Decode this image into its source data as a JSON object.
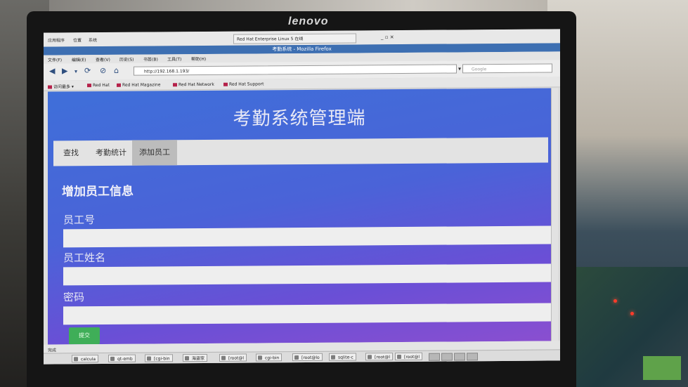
{
  "monitor": {
    "brand": "lenovo"
  },
  "os_panel": {
    "items": [
      "应用程序",
      "位置",
      "系统"
    ],
    "window_tab": "Red Hat Enterprise Linux 5 在线",
    "window_controls": "_ ▫ ✕"
  },
  "browser": {
    "title": "考勤系统 - Mozilla Firefox",
    "menu": [
      "文件(F)",
      "编辑(E)",
      "查看(V)",
      "历史(S)",
      "书签(B)",
      "工具(T)",
      "帮助(H)"
    ],
    "url": "http://192.168.1.193/",
    "search_placeholder": "Google",
    "bookmarks": [
      "访问最多 ▾",
      "Red Hat",
      "Red Hat Magazine",
      "Red Hat Network",
      "Red Hat Support"
    ],
    "status": "完成"
  },
  "page": {
    "title": "考勤系统管理端",
    "tabs": [
      "查找",
      "考勤统计",
      "添加员工"
    ],
    "active_tab": 2,
    "form_title": "增加员工信息",
    "fields": [
      {
        "label": "员工号",
        "value": ""
      },
      {
        "label": "员工姓名",
        "value": ""
      },
      {
        "label": "密码",
        "value": ""
      }
    ],
    "submit_label": "提交"
  },
  "taskbar": {
    "tasks": [
      "calcula",
      "qt-emb",
      "[cgi-bin",
      "海盗家",
      "[root@l",
      "cgi-bin",
      "[root@lo",
      "sqlite-c",
      "[root@l",
      "[root@l"
    ]
  },
  "colors": {
    "page_gradient_start": "#3f6fd9",
    "page_gradient_end": "#8a4fd0",
    "submit": "#3fae58",
    "tab_active": "#bcbcbc"
  }
}
